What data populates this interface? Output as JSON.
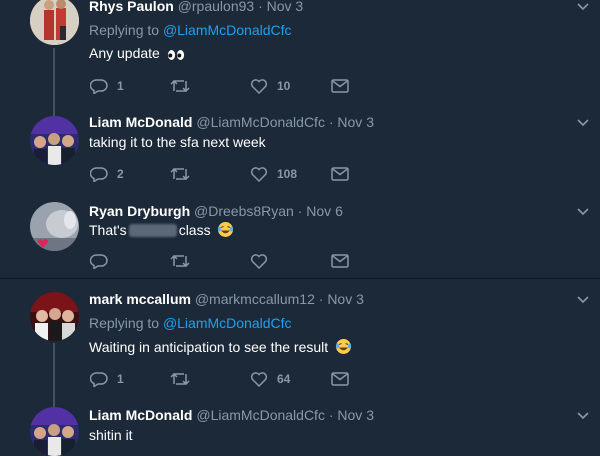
{
  "tweets": [
    {
      "name": "Rhys Paulon",
      "handle": "@rpaulon93",
      "sep": "·",
      "date": "Nov 3",
      "replying_prefix": "Replying to ",
      "replying_to": "@LiamMcDonaldCfc",
      "text": "Any update",
      "replies": "1",
      "retweets": "",
      "likes": "10"
    },
    {
      "name": "Liam McDonald",
      "handle": "@LiamMcDonaldCfc",
      "sep": "·",
      "date": "Nov 3",
      "text": "taking it to the sfa next week",
      "replies": "2",
      "retweets": "",
      "likes": "108"
    },
    {
      "name": "Ryan Dryburgh",
      "handle": "@Dreebs8Ryan",
      "sep": "·",
      "date": "Nov 6",
      "text_before": "That's",
      "text_after": "class",
      "replies": "",
      "retweets": "",
      "likes": ""
    },
    {
      "name": "mark mccallum",
      "handle": "@markmccallum12",
      "sep": "·",
      "date": "Nov 3",
      "replying_prefix": "Replying to ",
      "replying_to": "@LiamMcDonaldCfc",
      "text": "Waiting in anticipation to see the result",
      "replies": "1",
      "retweets": "",
      "likes": "64"
    },
    {
      "name": "Liam McDonald",
      "handle": "@LiamMcDonaldCfc",
      "sep": "·",
      "date": "Nov 3",
      "text": "shitin it"
    }
  ],
  "colors": {
    "background": "#1c2938",
    "secondary_text": "#8899a6",
    "link": "#1da1f2"
  },
  "icons": [
    "reply-icon",
    "retweet-icon",
    "like-icon",
    "direct-message-icon",
    "chevron-down-icon"
  ]
}
